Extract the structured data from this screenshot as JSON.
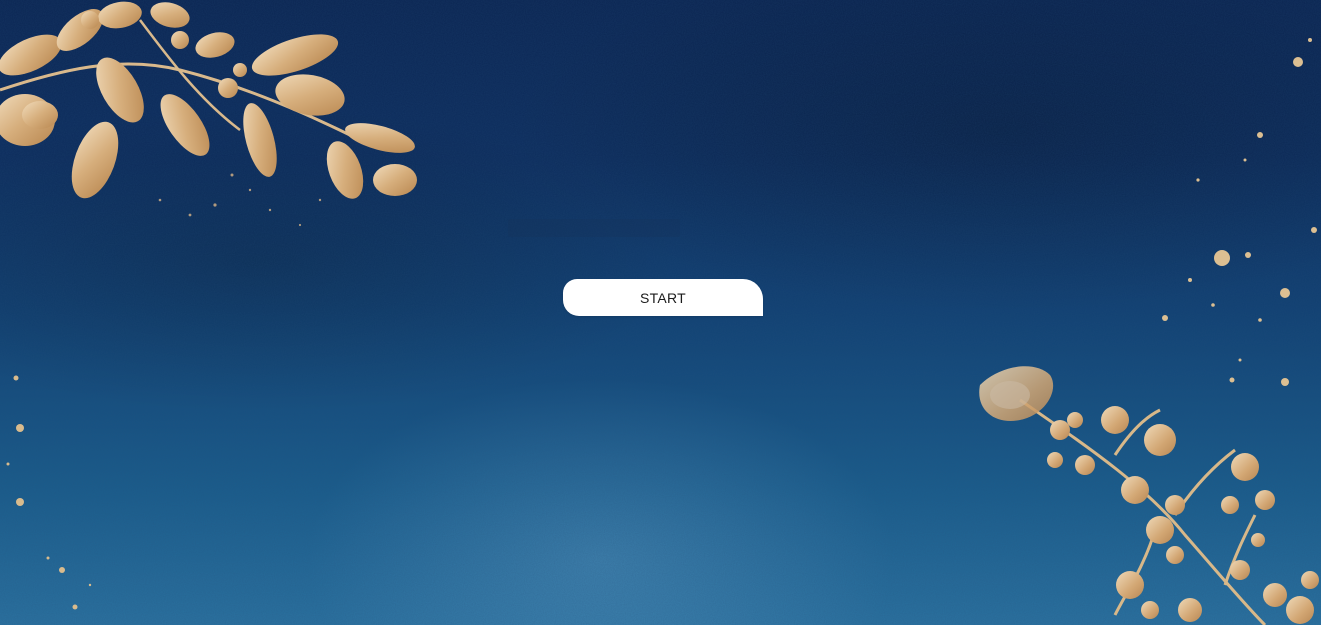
{
  "screen": {
    "start_label": "START"
  },
  "decor": {
    "background_icon": "watercolor-navy-background",
    "top_left_icon": "gold-leaf-branch-icon",
    "bottom_right_icon": "gold-berry-branch-icon",
    "speckle_icon": "gold-splatter-icon"
  },
  "colors": {
    "background_top": "#0b2552",
    "background_bottom": "#2b73a1",
    "gold_light": "#e3c49a",
    "gold_dark": "#b8864f",
    "button_bg": "#ffffff",
    "button_text": "#1b1b1b"
  }
}
